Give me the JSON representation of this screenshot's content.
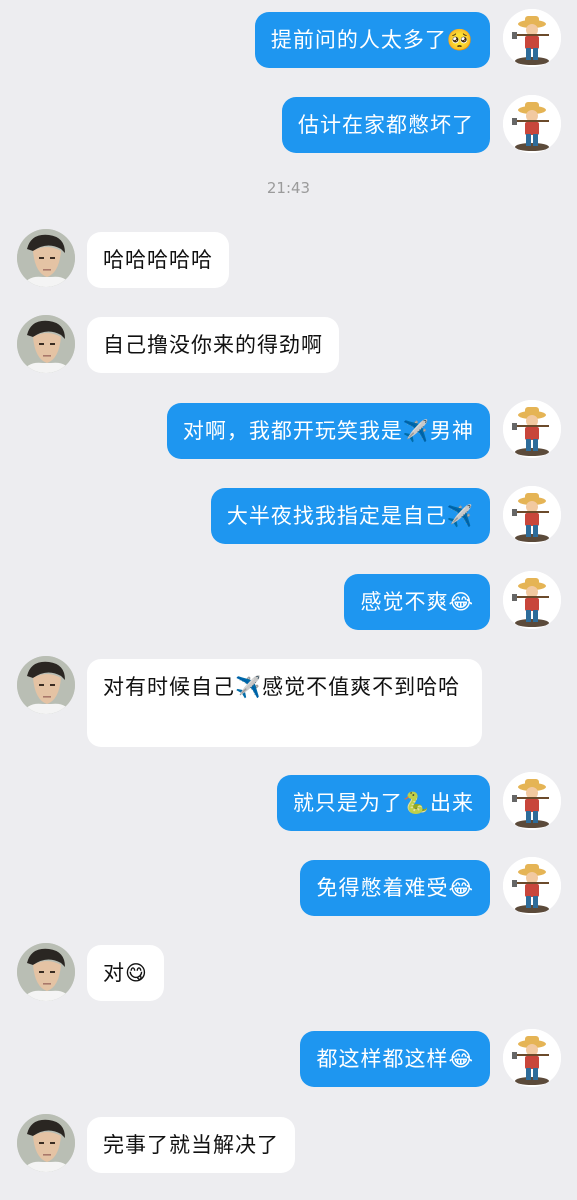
{
  "timestamp": "21:43",
  "messages": [
    {
      "side": "me",
      "text": "提前问的人太多了🥺"
    },
    {
      "side": "me",
      "text": "估计在家都憋坏了"
    },
    {
      "side": "other",
      "text": "哈哈哈哈哈"
    },
    {
      "side": "other",
      "text": "自己撸没你来的得劲啊"
    },
    {
      "side": "me",
      "text": "对啊，我都开玩笑我是✈️男神"
    },
    {
      "side": "me",
      "text": "大半夜找我指定是自己✈️"
    },
    {
      "side": "me",
      "text": "感觉不爽😂"
    },
    {
      "side": "other",
      "text": "对有时候自己✈️感觉不值爽不到哈哈"
    },
    {
      "side": "me",
      "text": "就只是为了🐍出来"
    },
    {
      "side": "me",
      "text": "免得憋着难受😂"
    },
    {
      "side": "other",
      "text": "对😋"
    },
    {
      "side": "me",
      "text": "都这样都这样😂"
    },
    {
      "side": "other",
      "text": "完事了就当解决了"
    }
  ],
  "avatars": {
    "me": "farmer-avatar",
    "other": "man-avatar"
  },
  "colors": {
    "background": "#ededf0",
    "my_bubble": "#1e96f0",
    "other_bubble": "#ffffff"
  }
}
